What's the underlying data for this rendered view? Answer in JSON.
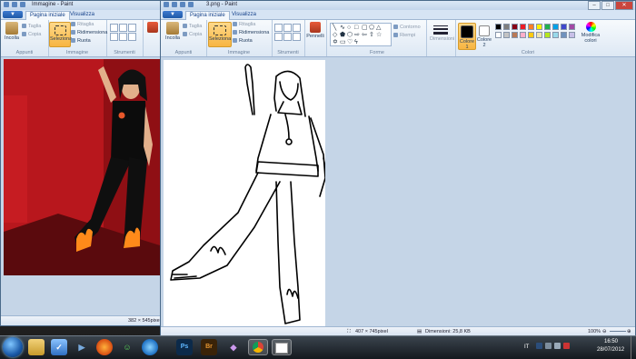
{
  "window1": {
    "title": "Immagine - Paint",
    "file_btn": "▼",
    "tabs": [
      "Pagina iniziale",
      "Visualizza"
    ],
    "groups": {
      "appunti": {
        "label": "Appunti",
        "paste": "Incolla",
        "cut": "Taglia",
        "copy": "Copia"
      },
      "immagine": {
        "label": "Immagine",
        "select": "Seleziona",
        "crop": "Ritaglia",
        "resize": "Ridimensiona",
        "rotate": "Ruota"
      },
      "strumenti": {
        "label": "Strumenti"
      }
    },
    "status": {
      "size": "382 × 545pixel"
    }
  },
  "window2": {
    "title": "3.png - Paint",
    "file_btn": "▼",
    "tabs": [
      "Pagina iniziale",
      "Visualizza"
    ],
    "groups": {
      "appunti": {
        "label": "Appunti",
        "paste": "Incolla",
        "cut": "Taglia",
        "copy": "Copia"
      },
      "immagine": {
        "label": "Immagine",
        "select": "Seleziona",
        "crop": "Ritaglia",
        "resize": "Ridimensiona",
        "rotate": "Ruota"
      },
      "strumenti": {
        "label": "Strumenti",
        "brushes": "Pennelli"
      },
      "forme": {
        "label": "Forme",
        "outline": "Contorno",
        "fill": "Riempi"
      },
      "dimensioni": {
        "label": "Dimensioni"
      },
      "colori": {
        "label": "Colori",
        "color1": "Colore 1",
        "color2": "Colore 2",
        "edit": "Modifica colori"
      }
    },
    "status": {
      "size": "407 × 745pixel",
      "filesize": "Dimensioni: 25,8 KB",
      "zoom": "100%"
    }
  },
  "palette": [
    "#000000",
    "#7f7f7f",
    "#880015",
    "#ed1c24",
    "#ff7f27",
    "#fff200",
    "#22b14c",
    "#00a2e8",
    "#3f48cc",
    "#a349a4",
    "#ffffff",
    "#c3c3c3",
    "#b97a57",
    "#ffaec9",
    "#ffc90e",
    "#efe4b0",
    "#b5e61d",
    "#99d9ea",
    "#7092be",
    "#c8bfe7"
  ],
  "colors": {
    "color1": "#000000",
    "color2": "#ffffff",
    "accent": "#f7b542"
  },
  "taskbar": {
    "apps": [
      "folder-icon",
      "mail-icon",
      "media-player-icon",
      "firefox-icon",
      "messenger-icon",
      "explorer-icon",
      "photoshop-icon",
      "bridge-icon",
      "paint-net-icon",
      "chrome-icon",
      "paint-icon"
    ],
    "ps_label": "Ps",
    "br_label": "Br",
    "lang": "IT",
    "time": "16:50",
    "date": "28/07/2012"
  }
}
